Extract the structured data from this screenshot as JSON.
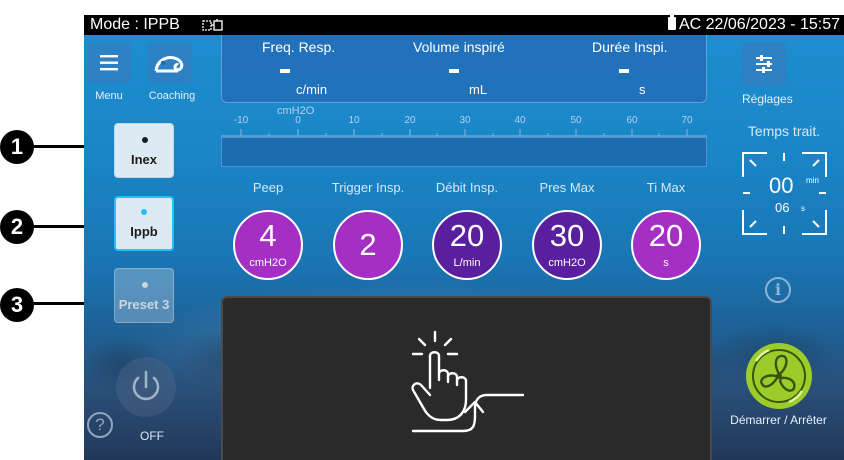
{
  "status_bar": {
    "mode_text": "Mode : IPPB",
    "power_source": "AC",
    "datetime": "22/06/2023 - 15:57"
  },
  "nav": {
    "menu_label": "Menu",
    "coaching_label": "Coaching"
  },
  "readouts": [
    {
      "label": "Freq. Resp.",
      "value": "-",
      "unit": "c/min"
    },
    {
      "label": "Volume inspiré",
      "value": "-",
      "unit": "mL"
    },
    {
      "label": "Durée Inspi.",
      "value": "-",
      "unit": "s"
    }
  ],
  "gauge": {
    "unit": "cmH2O",
    "ticks": [
      "-10",
      "0",
      "10",
      "20",
      "30",
      "40",
      "50",
      "60",
      "70"
    ]
  },
  "presets": [
    {
      "label": "Inex",
      "state": "available"
    },
    {
      "label": "Ippb",
      "state": "selected"
    },
    {
      "label": "Preset 3",
      "state": "disabled"
    }
  ],
  "params": [
    {
      "label": "Peep",
      "value": "4",
      "unit": "cmH2O",
      "color": "#a52fc4"
    },
    {
      "label": "Trigger Insp.",
      "value": "2",
      "unit": "",
      "color": "#a52fc4"
    },
    {
      "label": "Débit Insp.",
      "value": "20",
      "unit": "L/min",
      "color": "#5a1f9e"
    },
    {
      "label": "Pres Max",
      "value": "30",
      "unit": "cmH2O",
      "color": "#5a1f9e"
    },
    {
      "label": "Ti Max",
      "value": "20",
      "unit": "s",
      "color": "#a52fc4"
    }
  ],
  "right": {
    "settings_label": "Réglages",
    "timer_title": "Temps trait.",
    "timer_minutes": "00",
    "timer_min_unit": "min",
    "timer_seconds": "06",
    "timer_sec_unit": "s",
    "start_stop_label": "Démarrer / Arrêter"
  },
  "bottom": {
    "power_label": "OFF"
  },
  "callouts": [
    "1",
    "2",
    "3"
  ],
  "colors": {
    "accent_selected": "#27c0ff",
    "start_green": "#9ccc29",
    "param_magenta": "#a52fc4",
    "param_purple": "#5a1f9e"
  },
  "icons": {
    "menu": "hamburger-icon",
    "coaching": "chameleon-icon",
    "settings": "sliders-icon",
    "timer": "timer-frame-icon",
    "info": "info-icon",
    "start": "fan-icon",
    "power": "power-icon",
    "help": "help-icon",
    "touch": "touch-trigger-icon"
  }
}
